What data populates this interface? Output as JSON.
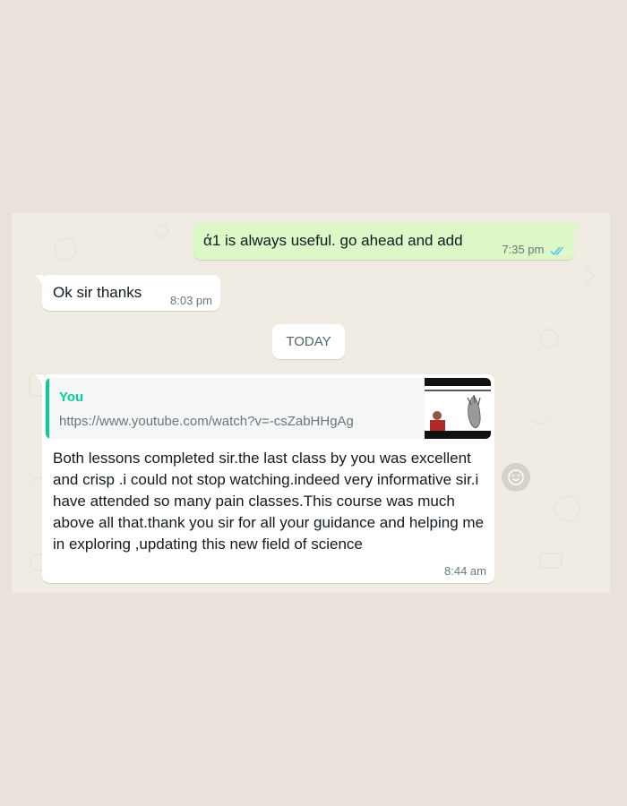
{
  "messages": [
    {
      "direction": "outgoing",
      "text": "ά1 is always useful. go ahead and add",
      "time": "7:35 pm",
      "status": "read"
    },
    {
      "direction": "incoming",
      "text": "Ok sir thanks",
      "time": "8:03 pm"
    },
    {
      "direction": "incoming",
      "quote": {
        "author": "You",
        "link": "https://www.youtube.com/watch?v=-csZabHHgAg"
      },
      "text": "Both lessons completed sir.the last class by you was excellent and crisp .i could not stop watching.indeed very informative sir.i have attended so many pain classes.This course was much above all that.thank you sir for all your guidance and helping me in exploring ,updating this new field of science",
      "time": "8:44 am"
    }
  ],
  "date_separator": "TODAY",
  "colors": {
    "outgoing_bubble": "#dcf8c6",
    "incoming_bubble": "#ffffff",
    "read_ticks": "#53bdeb",
    "quote_accent": "#06cf9c",
    "chat_background": "#f0ece3"
  },
  "icons": {
    "read_status": "double-check-icon",
    "reaction": "smiley-icon"
  }
}
